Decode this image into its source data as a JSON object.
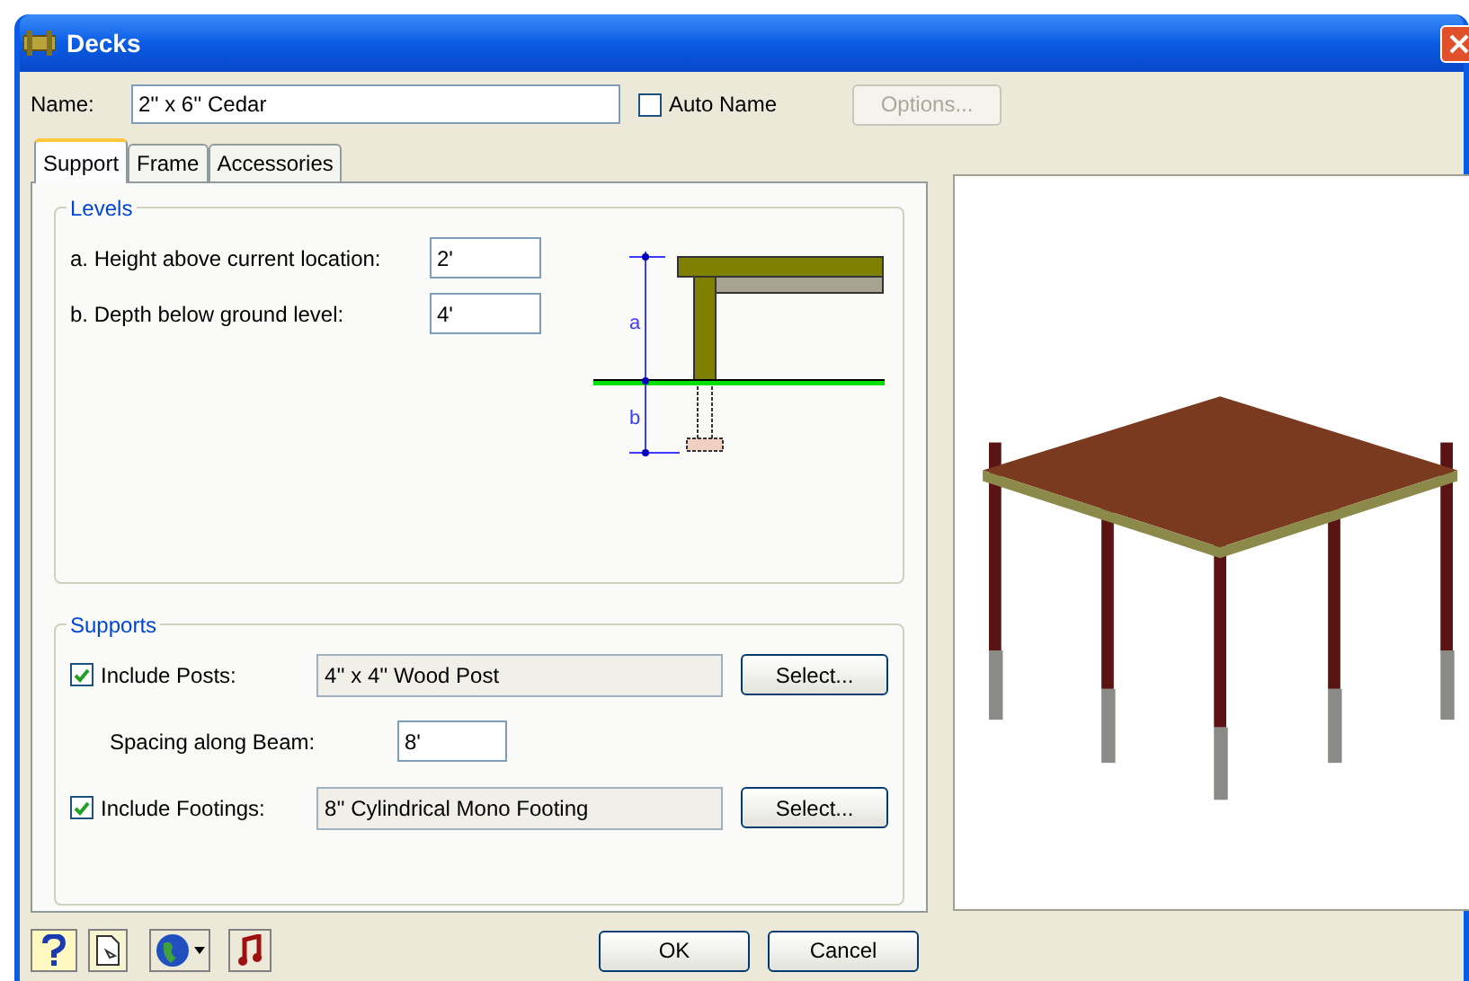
{
  "window": {
    "title": "Decks"
  },
  "name_field": {
    "label": "Name:",
    "value": "2'' x 6'' Cedar"
  },
  "auto_name": {
    "label": "Auto Name",
    "checked": false
  },
  "options_button": {
    "label": "Options...",
    "disabled": true
  },
  "tabs": [
    {
      "label": "Support",
      "selected": true
    },
    {
      "label": "Frame",
      "selected": false
    },
    {
      "label": "Accessories",
      "selected": false
    }
  ],
  "levels": {
    "title": "Levels",
    "fields": [
      {
        "label": "a. Height above current location:",
        "value": "2'"
      },
      {
        "label": "b. Depth below ground level:",
        "value": "4'"
      }
    ],
    "diagram_labels": [
      "a",
      "b"
    ]
  },
  "supports": {
    "title": "Supports",
    "posts": {
      "label": "Include Posts:",
      "checked": true,
      "value": "4'' x 4'' Wood Post",
      "button": "Select..."
    },
    "spacing": {
      "label": "Spacing along Beam:",
      "value": "8'"
    },
    "footings": {
      "label": "Include Footings:",
      "checked": true,
      "value": "8'' Cylindrical Mono Footing",
      "button": "Select..."
    }
  },
  "buttons": [
    {
      "label": "OK"
    },
    {
      "label": "Cancel"
    }
  ]
}
